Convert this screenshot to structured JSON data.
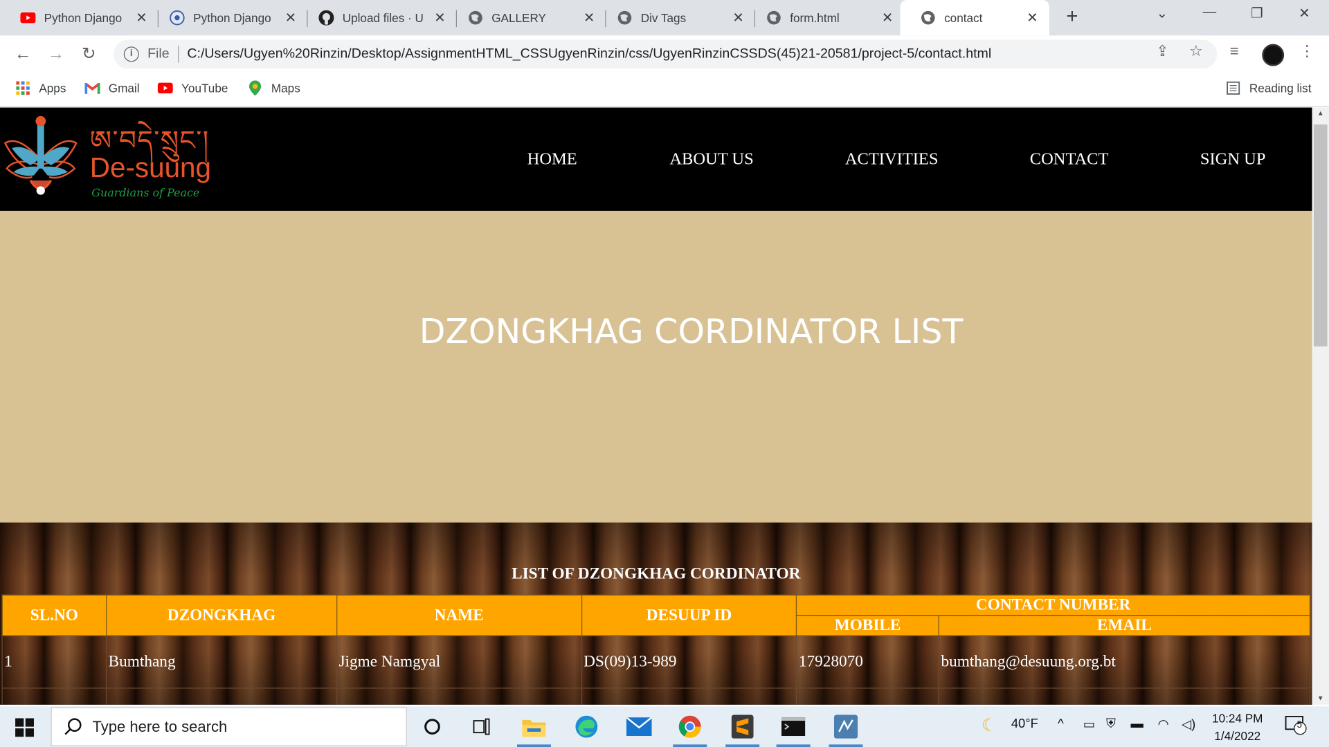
{
  "browser": {
    "tabs": [
      {
        "title": "Python Django",
        "icon": "youtube-icon",
        "active": false
      },
      {
        "title": "Python Django",
        "icon": "site-icon",
        "active": false
      },
      {
        "title": "Upload files · U",
        "icon": "github-icon",
        "active": false
      },
      {
        "title": "GALLERY",
        "icon": "globe-icon",
        "active": false
      },
      {
        "title": "Div Tags",
        "icon": "globe-icon",
        "active": false
      },
      {
        "title": "form.html",
        "icon": "globe-icon",
        "active": false
      },
      {
        "title": "contact",
        "icon": "globe-icon",
        "active": true
      }
    ],
    "address": {
      "scheme_label": "File",
      "url": "C:/Users/Ugyen%20Rinzin/Desktop/AssignmentHTML_CSSUgyenRinzin/css/UgyenRinzinCSSDS(45)21-20581/project-5/contact.html"
    },
    "bookmarks": [
      {
        "label": "Apps",
        "icon": "apps-grid-icon"
      },
      {
        "label": "Gmail",
        "icon": "gmail-icon"
      },
      {
        "label": "YouTube",
        "icon": "youtube-icon"
      },
      {
        "label": "Maps",
        "icon": "maps-pin-icon"
      }
    ],
    "reading_list": "Reading list"
  },
  "site": {
    "logo": {
      "script": "ཨ་བདེ་སྲུང་།",
      "name": "De-suung",
      "tagline": "Guardians of Peace"
    },
    "nav": [
      "HOME",
      "ABOUT US",
      "ACTIVITIES",
      "CONTACT",
      "SIGN UP"
    ],
    "hero_title": "DZONGKHAG CORDINATOR LIST",
    "table": {
      "caption": "LIST OF DZONGKHAG CORDINATOR",
      "headers": {
        "slno": "SL.NO",
        "dzongkhag": "DZONGKHAG",
        "name": "NAME",
        "desuup_id": "DESUUP ID",
        "contact": "CONTACT NUMBER",
        "mobile": "MOBILE",
        "email": "EMAIL"
      },
      "rows": [
        {
          "slno": "1",
          "dzongkhag": "Bumthang",
          "name": "Jigme Namgyal",
          "desuup_id": "DS(09)13-989",
          "mobile": "17928070",
          "email": "bumthang@desuung.org.bt"
        }
      ]
    }
  },
  "taskbar": {
    "search_placeholder": "Type here to search",
    "weather": "40°F",
    "time": "10:24 PM",
    "date": "1/4/2022",
    "notification_count": "5"
  }
}
